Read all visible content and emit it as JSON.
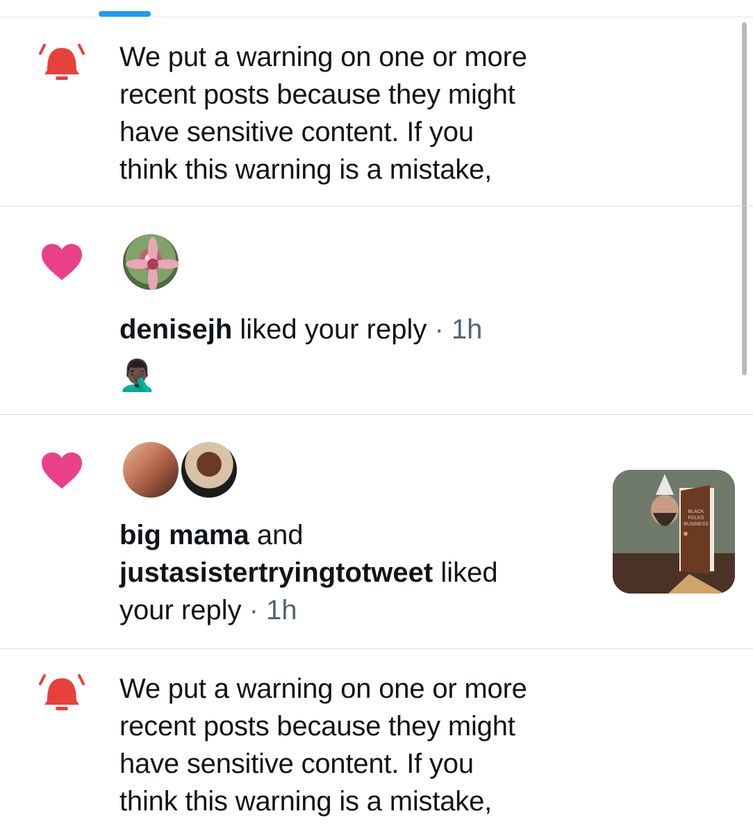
{
  "notifications": [
    {
      "type": "warning",
      "icon": "alert-bell-icon",
      "text_lines": [
        "We put a warning on one or more",
        "recent posts because they might",
        "have sensitive content. If you",
        "think this warning is a mistake,"
      ]
    },
    {
      "type": "like",
      "icon": "heart-icon",
      "user": "denisejh",
      "action": " liked your reply",
      "time": " · 1h",
      "quoted_emoji": "🤦🏿‍♂️"
    },
    {
      "type": "like",
      "icon": "heart-icon",
      "user1": "big mama",
      "connector": " and",
      "user2": "justasistertryingtotweet",
      "action1": " liked",
      "action2": "your reply",
      "time": " · 1h",
      "thumbnail_text": [
        "BLACK",
        "FOLKS",
        "BUSINESS"
      ]
    },
    {
      "type": "warning",
      "icon": "alert-bell-icon",
      "text_lines": [
        "We put a warning on one or more",
        "recent posts because they might",
        "have sensitive content. If you",
        "think this warning is a mistake,"
      ]
    }
  ],
  "colors": {
    "alert_red": "#e8403a",
    "heart_pink": "#e8418a",
    "link_blue": "#1d9bf0",
    "muted_gray": "#536471"
  }
}
